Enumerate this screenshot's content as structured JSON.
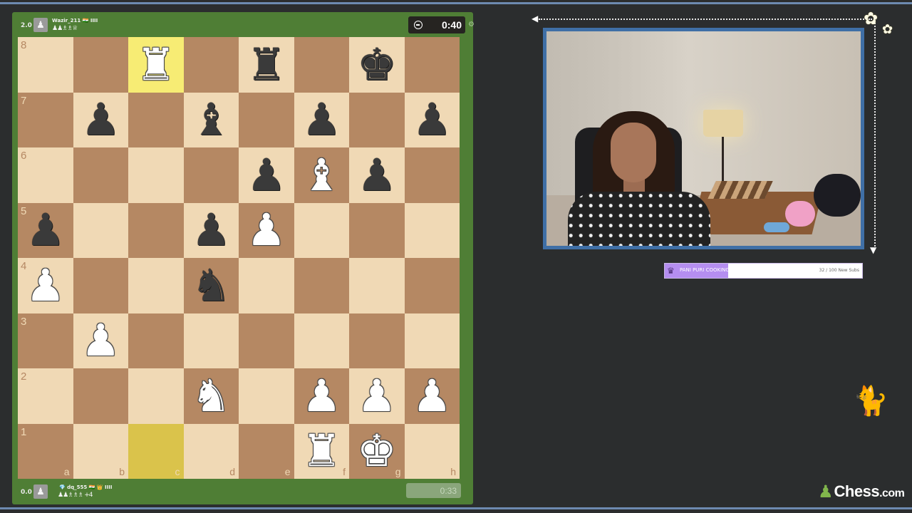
{
  "top_player": {
    "score": "2.0",
    "name": "Wazir_211 🇮🇳 ⅠⅠⅠⅠ",
    "captured": "♟♟♗♗♕",
    "clock": "0:40"
  },
  "bottom_player": {
    "score": "0.0",
    "name": "💎 dq_555 🇮🇳 👑 ⅠⅠⅠⅠ",
    "captured": "♟♟♗♗♗ +4",
    "clock": "0:33"
  },
  "board": {
    "highlight_squares": [
      "c8",
      "c1"
    ],
    "pieces": {
      "c8": "♜",
      "e8": "♜",
      "g8": "♚",
      "b7": "♟",
      "d7": "♝",
      "f7": "♟",
      "h7": "♟",
      "e6": "♟",
      "f6": "♝",
      "g6": "♟",
      "a5": "♟",
      "d5": "♟",
      "e5": "♟",
      "a4": "♟",
      "d4": "♞",
      "b3": "♟",
      "d2": "♞",
      "f2": "♟",
      "g2": "♟",
      "h2": "♟",
      "f1": "♜",
      "g1": "♚"
    },
    "colors": {
      "c8": "w",
      "e8": "b",
      "g8": "b",
      "b7": "b",
      "d7": "b",
      "f7": "b",
      "h7": "b",
      "e6": "b",
      "f6": "w",
      "g6": "b",
      "a5": "b",
      "d5": "b",
      "e5": "w",
      "a4": "w",
      "d4": "b",
      "b3": "w",
      "d2": "w",
      "f2": "w",
      "g2": "w",
      "h2": "w",
      "f1": "w",
      "g1": "w"
    },
    "ranks": [
      "8",
      "7",
      "6",
      "5",
      "4",
      "3",
      "2",
      "1"
    ],
    "files": [
      "a",
      "b",
      "c",
      "d",
      "e",
      "f",
      "g",
      "h"
    ],
    "light_color": "#f0d9b5",
    "dark_color": "#b58863"
  },
  "sub_goal": {
    "label": "PANI PURI COOKING STREAM",
    "count": "32 / 100 New Subs",
    "progress": 0.32,
    "icon": "trophy-icon"
  },
  "brand": {
    "name": "Chess",
    "suffix": ".com",
    "icon": "pawn-icon"
  },
  "colors": {
    "panel_green": "#4f7e35",
    "frame_blue": "#3f6fa6",
    "goal_purple": "#b58ef0"
  }
}
